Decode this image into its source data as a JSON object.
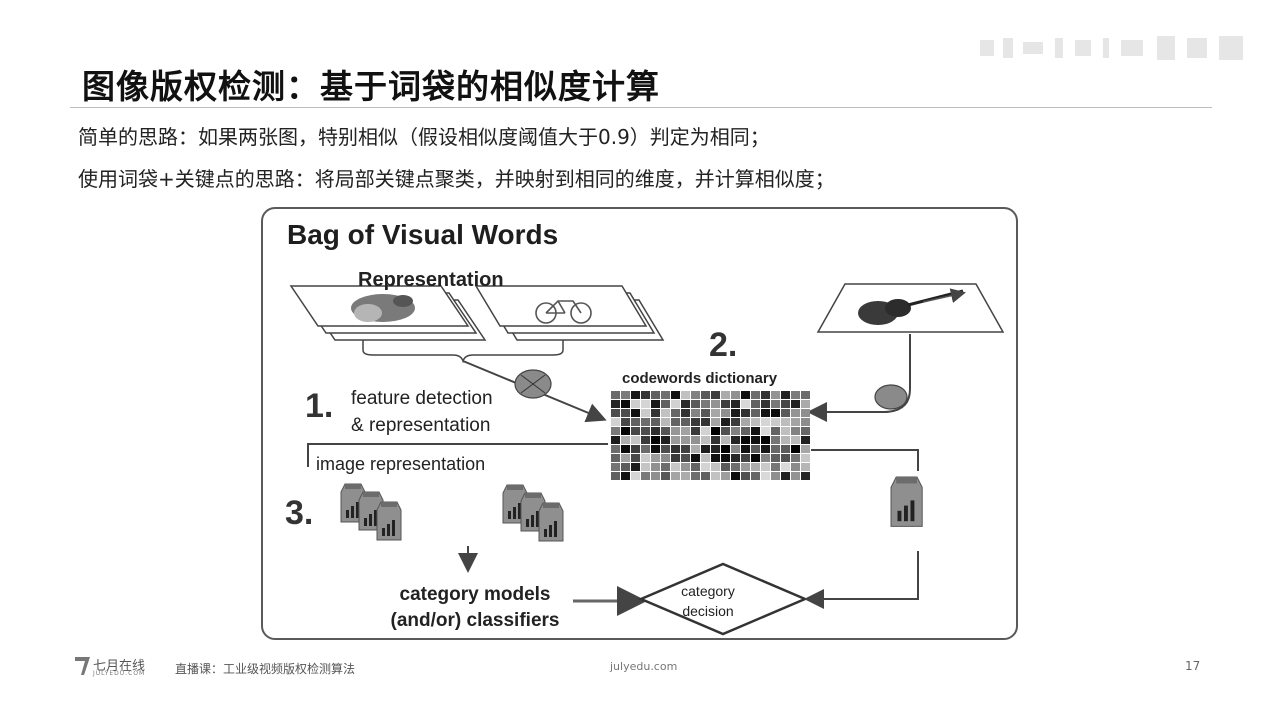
{
  "slide": {
    "title": "图像版权检测：基于词袋的相似度计算",
    "bullets": [
      "简单的思路：如果两张图，特别相似（假设相似度阈值大于0.9）判定为相同；",
      "使用词袋+关键点的思路：将局部关键点聚类，并映射到相同的维度，并计算相似度；"
    ]
  },
  "figure": {
    "title": "Bag of Visual Words",
    "representation_label": "Representation",
    "step1_number": "1.",
    "step1_label_line1": "feature detection",
    "step1_label_line2": "& representation",
    "step2_number": "2.",
    "step2_label": "codewords dictionary",
    "step3_number": "3.",
    "image_representation_label": "image representation",
    "category_models_line1": "category models",
    "category_models_line2": "(and/or) classifiers",
    "category_decision_line1": "category",
    "category_decision_line2": "decision"
  },
  "footer": {
    "brand": "七月在线",
    "brand_sub": "JULYEDU.COM",
    "course": "直播课：工业级视频版权检测算法",
    "site": "julyedu.com",
    "page": "17"
  },
  "colors": {
    "title": "#111111",
    "text": "#222222",
    "figure_border": "#5a5a5a",
    "arrow": "#444444",
    "ellipse": "#8a8a8a"
  }
}
